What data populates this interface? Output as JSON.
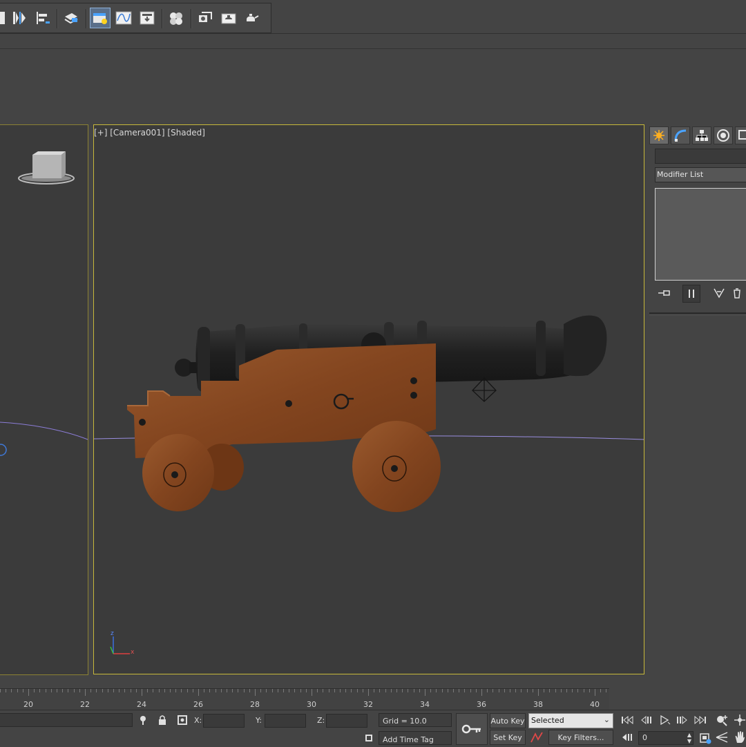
{
  "viewport": {
    "label": "[+] [Camera001] [Shaded]"
  },
  "command_panel": {
    "modifier_list": "Modifier List"
  },
  "timeline": {
    "ticks": [
      "20",
      "22",
      "24",
      "26",
      "28",
      "30",
      "32",
      "34",
      "36",
      "38",
      "40"
    ]
  },
  "status_bar": {
    "x_label": "X:",
    "y_label": "Y:",
    "z_label": "Z:",
    "grid": "Grid = 10.0",
    "add_time_tag": "Add Time Tag",
    "auto_key": "Auto Key",
    "set_key": "Set Key",
    "selected": "Selected",
    "key_filters": "Key Filters...",
    "frame": "0"
  },
  "axis_gizmo": {
    "z": "z",
    "x": "x"
  },
  "colors": {
    "active_viewport_border": "#c8b93a",
    "wood": "#8a4a22",
    "barrel": "#1e1e1e"
  }
}
